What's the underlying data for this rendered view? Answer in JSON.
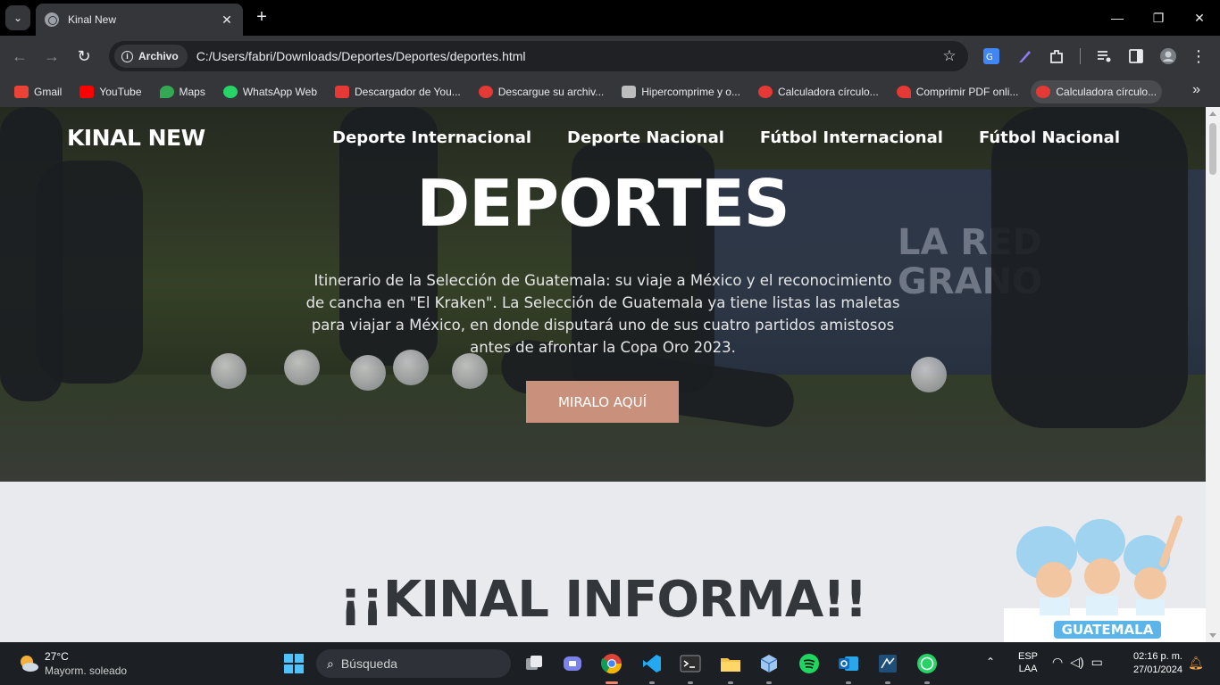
{
  "browser": {
    "tab": {
      "title": "Kinal New",
      "close": "✕"
    },
    "new_tab": "+",
    "window": {
      "minimize": "—",
      "maximize": "❐",
      "close": "✕"
    },
    "omnibox": {
      "chip_label": "Archivo",
      "url": "C:/Users/fabri/Downloads/Deportes/Deportes/deportes.html"
    },
    "bookmarks": [
      {
        "label": "Gmail",
        "icon": "gmail-icon",
        "color": "#ea4335"
      },
      {
        "label": "YouTube",
        "icon": "youtube-icon",
        "color": "#ff0000"
      },
      {
        "label": "Maps",
        "icon": "maps-icon",
        "color": "#34a853"
      },
      {
        "label": "WhatsApp Web",
        "icon": "whatsapp-icon",
        "color": "#25d366"
      },
      {
        "label": "Descargador de You...",
        "icon": "download-icon",
        "color": "#e53935"
      },
      {
        "label": "Descargue su archiv...",
        "icon": "convert-icon",
        "color": "#e53935"
      },
      {
        "label": "Hipercomprime y o...",
        "icon": "compress-icon",
        "color": "#bdbdbd"
      },
      {
        "label": "Calculadora círculo...",
        "icon": "calculator-icon",
        "color": "#e53935"
      },
      {
        "label": "Comprimir PDF onli...",
        "icon": "heart-icon",
        "color": "#e53935"
      },
      {
        "label": "Calculadora círculo...",
        "icon": "calculator-icon",
        "color": "#e53935"
      }
    ],
    "bookmarks_more": "»"
  },
  "page": {
    "brand": "KINAL NEW",
    "nav": [
      "Deporte Internacional",
      "Deporte Nacional",
      "Fútbol Internacional",
      "Fútbol Nacional"
    ],
    "hero": {
      "title": "DEPORTES",
      "lead": "Itinerario de la Selección de Guatemala: su viaje a México y el reconocimiento de cancha en \"El Kraken\". La Selección de Guatemala ya tiene listas las maletas para viajar a México, en donde disputará uno de sus cuatro partidos amistosos antes de afrontar la Copa Oro 2023.",
      "cta": "MIRALO AQUÍ",
      "background_text": "LA RED\nGRANO"
    },
    "section_title": "¡¡KINAL INFORMA!!",
    "mascot_banner": "GUATEMALA",
    "colors": {
      "cta": "#c9917c",
      "section_bg": "#e9eaee",
      "heading": "#33363b"
    }
  },
  "taskbar": {
    "weather": {
      "temp": "27°C",
      "summary": "Mayorm. soleado"
    },
    "search_placeholder": "Búsqueda",
    "lang": {
      "line1": "ESP",
      "line2": "LAA"
    },
    "time": "02:16 p. m.",
    "date": "27/01/2024"
  }
}
